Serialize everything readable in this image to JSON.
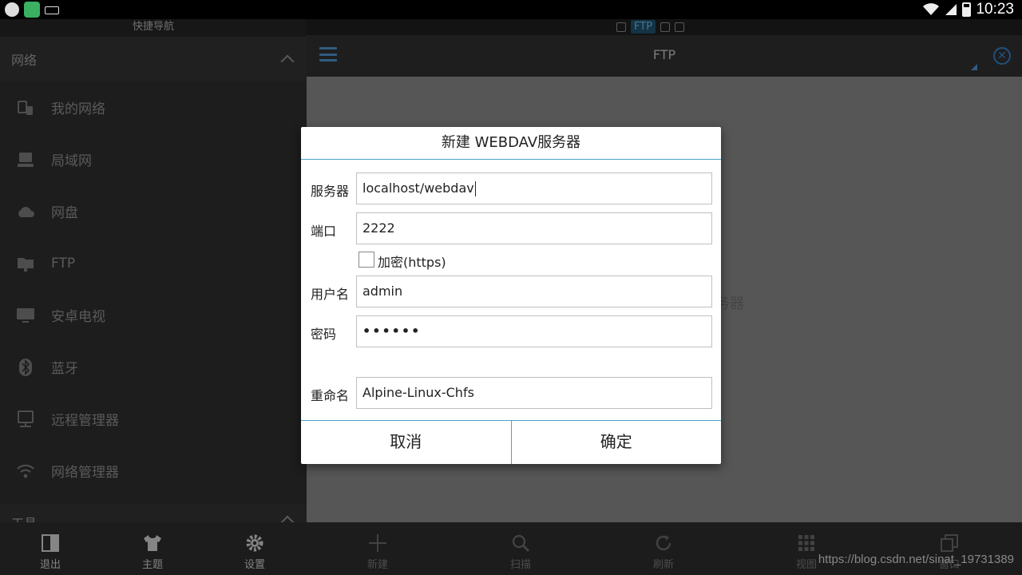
{
  "status_bar": {
    "time": "10:23"
  },
  "drawer": {
    "title": "快捷导航",
    "section_network": "网络",
    "items": [
      {
        "label": "我的网络",
        "icon": "my-network-icon"
      },
      {
        "label": "局域网",
        "icon": "lan-icon"
      },
      {
        "label": "网盘",
        "icon": "cloud-icon"
      },
      {
        "label": "FTP",
        "icon": "ftp-folder-icon"
      },
      {
        "label": "安卓电视",
        "icon": "tv-icon"
      },
      {
        "label": "蓝牙",
        "icon": "bluetooth-icon"
      },
      {
        "label": "远程管理器",
        "icon": "remote-manager-icon"
      },
      {
        "label": "网络管理器",
        "icon": "wifi-icon"
      }
    ],
    "section_tools": "工具"
  },
  "path_bar": {
    "chip": "FTP"
  },
  "toolbar": {
    "title": "FTP"
  },
  "content": {
    "hint_fragment": "务器"
  },
  "bottom_bar": {
    "left": [
      {
        "label": "退出",
        "icon": "exit-icon"
      },
      {
        "label": "主题",
        "icon": "theme-shirt-icon"
      },
      {
        "label": "设置",
        "icon": "settings-gear-icon"
      }
    ],
    "right": [
      {
        "label": "新建",
        "icon": "plus-icon"
      },
      {
        "label": "扫描",
        "icon": "search-icon"
      },
      {
        "label": "刷新",
        "icon": "refresh-icon"
      },
      {
        "label": "视图",
        "icon": "grid-view-icon"
      },
      {
        "label": "窗口",
        "icon": "windows-icon"
      }
    ],
    "watermark": "https://blog.csdn.net/sinat_19731389"
  },
  "dialog": {
    "title": "新建 WEBDAV服务器",
    "server_label": "服务器",
    "server_value": "localhost/webdav",
    "port_label": "端口",
    "port_value": "2222",
    "encrypt_label": "加密(https)",
    "encrypt_checked": false,
    "username_label": "用户名",
    "username_value": "admin",
    "password_label": "密码",
    "password_value": "••••••",
    "rename_label": "重命名",
    "rename_value": "Alpine-Linux-Chfs",
    "cancel_label": "取消",
    "ok_label": "确定"
  },
  "colors": {
    "accent": "#4aa3c8",
    "icon_blue": "#2f7fc0"
  }
}
